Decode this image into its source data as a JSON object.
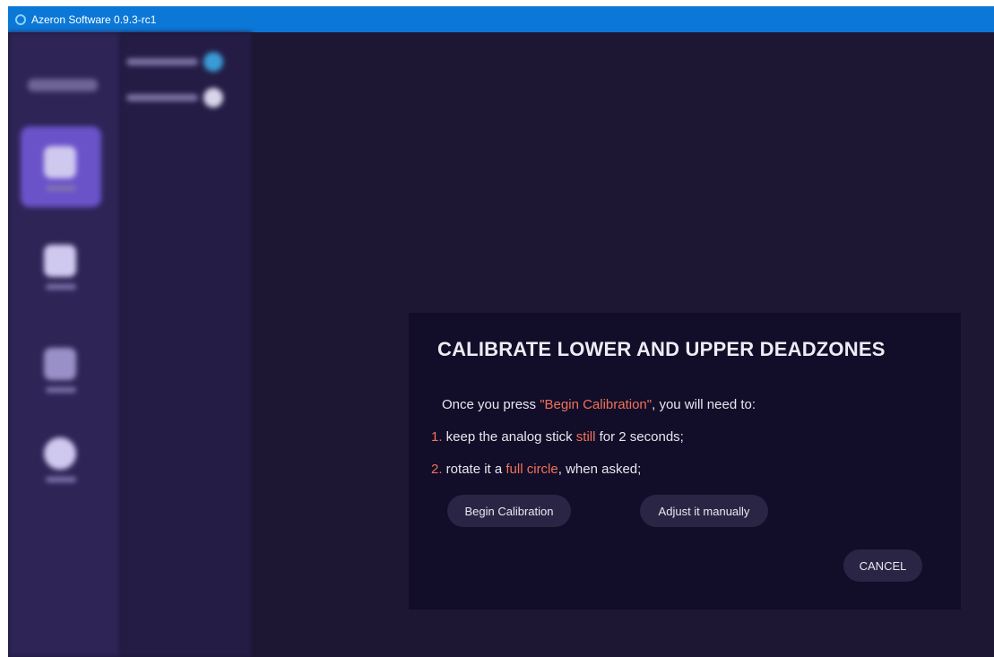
{
  "window": {
    "title": "Azeron Software 0.9.3-rc1",
    "app_icon": "azeron-logo-icon",
    "titlebar_color": "#0b78d7"
  },
  "theme": {
    "background": "#1d1733",
    "sidebar": "#2e2456",
    "dialog": "#120d28",
    "highlight": "#f0725a",
    "button": "#2a2544"
  },
  "dialog": {
    "title": "CALIBRATE LOWER AND UPPER DEADZONES",
    "intro": {
      "before": "Once you press ",
      "highlight": "\"Begin Calibration\"",
      "after": ", you will need to:"
    },
    "step1": {
      "number": "1.",
      "before": " keep the analog stick ",
      "highlight": "still",
      "after": " for 2 seconds;"
    },
    "step2": {
      "number": "2.",
      "before": " rotate it a ",
      "highlight": "full circle",
      "after": ", when asked;"
    },
    "buttons": {
      "begin": "Begin Calibration",
      "manual": "Adjust it manually",
      "cancel": "CANCEL"
    }
  }
}
